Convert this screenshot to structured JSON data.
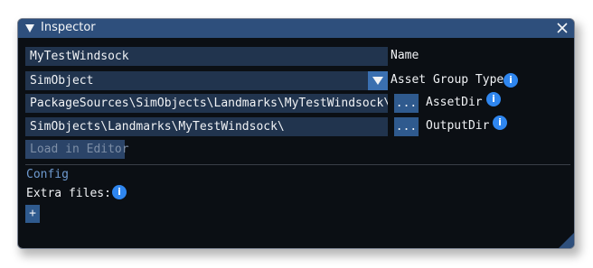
{
  "window": {
    "title": "Inspector",
    "title_arrow": "▼",
    "icons": {
      "collapse": "triangle-down-icon",
      "close": "close-icon",
      "resize": "resize-grip-icon"
    }
  },
  "fields": {
    "name_value": "MyTestWindsock",
    "name_label": "Name",
    "group_value": "SimObject",
    "group_label": "Asset Group Type",
    "asset_dir_value": "PackageSources\\SimObjects\\Landmarks\\MyTestWindsock\\",
    "asset_dir_label": "AssetDir",
    "output_dir_value": "SimObjects\\Landmarks\\MyTestWindsock\\",
    "output_dir_label": "OutputDir"
  },
  "buttons": {
    "browse": "...",
    "load_in_editor": "Load in Editor",
    "add": "+"
  },
  "config": {
    "section_title": "Config",
    "extra_files_label": "Extra files:"
  },
  "info_icon": "i",
  "colors": {
    "titlebar": "#2e4f7c",
    "field": "#21344e",
    "accent": "#3a6fb0",
    "info": "#2f86ef",
    "section": "#6e9ad0",
    "background": "#0b0f14"
  }
}
